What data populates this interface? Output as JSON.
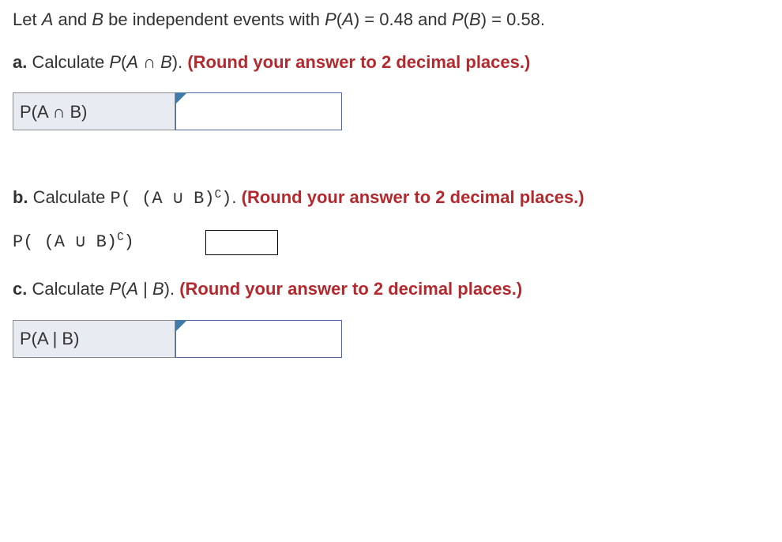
{
  "given": {
    "prefix": "Let ",
    "A": "A",
    "and": " and ",
    "B": "B",
    "mid": " be independent events with ",
    "PA_lhs": "P",
    "PA_open": "(",
    "PA_var": "A",
    "PA_close": ")",
    "eq1": " = ",
    "PA_val": "0.48",
    "and2": " and ",
    "PB_lhs": "P",
    "PB_open": "(",
    "PB_var": "B",
    "PB_close": ")",
    "eq2": " = ",
    "PB_val": "0.58",
    "period": "."
  },
  "a": {
    "label": "a.",
    "text": " Calculate ",
    "expr_P": "P",
    "expr_open": "(",
    "expr_A": "A",
    "expr_op": " ∩ ",
    "expr_B": "B",
    "expr_close": ")",
    "period": ". ",
    "note": "(Round your answer to 2 decimal places.)",
    "box_label": "P(A ∩ B)"
  },
  "b": {
    "label": "b.",
    "text": " Calculate ",
    "expr": "P( (A ∪ B)",
    "sup": "C",
    "expr_end": ")",
    "period": ". ",
    "note": "(Round your answer to 2 decimal places.)",
    "row_label": "P( (A ∪ B)",
    "row_sup": "C",
    "row_end": ")"
  },
  "c": {
    "label": "c.",
    "text": " Calculate ",
    "expr_P": "P",
    "expr_open": "(",
    "expr_A": "A",
    "expr_bar": " | ",
    "expr_B": "B",
    "expr_close": ")",
    "period": ". ",
    "note": "(Round your answer to 2 decimal places.)",
    "box_label": "P(A | B)"
  }
}
